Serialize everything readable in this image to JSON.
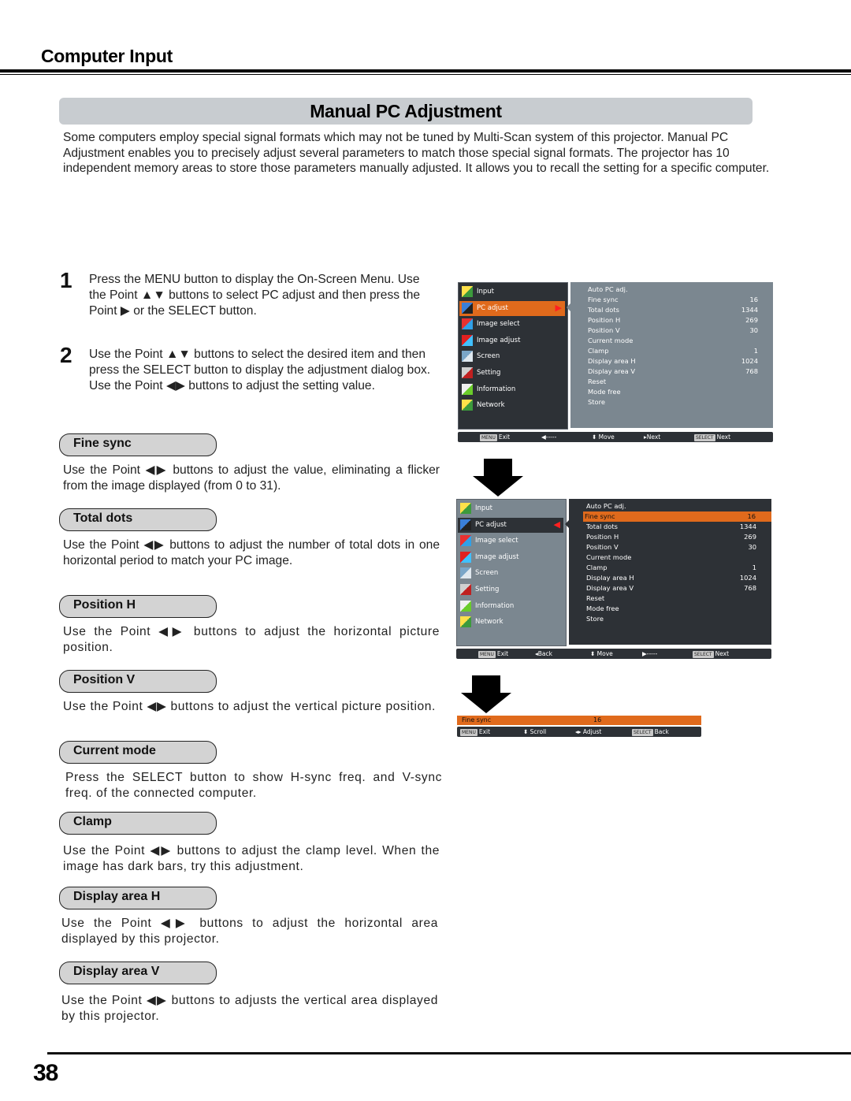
{
  "header": {
    "section_title": "Computer Input"
  },
  "banner": {
    "title": "Manual PC Adjustment"
  },
  "intro": "Some computers employ special signal formats which may not be tuned by Multi-Scan system of this projector. Manual PC Adjustment enables you to precisely adjust several parameters to match those special signal formats. The projector has 10 independent memory areas to store those parameters manually adjusted. It allows you to recall the setting for a specific computer.",
  "steps": [
    {
      "number": "1",
      "text": "Press the MENU button to display the On-Screen Menu. Use the Point ▲▼ buttons to select PC adjust and then press the Point ▶ or the SELECT button."
    },
    {
      "number": "2",
      "text": "Use the Point ▲▼ buttons to select the desired item and then press the SELECT button to display the adjustment dialog box. Use the Point ◀▶ buttons to adjust the setting value."
    }
  ],
  "items": [
    {
      "title": "Fine sync",
      "desc": "Use the Point ◀▶ buttons to adjust the value, eliminating a flicker from the image displayed (from 0 to 31)."
    },
    {
      "title": "Total dots",
      "desc": "Use the Point ◀▶ buttons to adjust the number of total dots in one horizontal period to match your PC image."
    },
    {
      "title": "Position H",
      "desc": "Use the Point ◀▶ buttons to adjust the horizontal picture position."
    },
    {
      "title": "Position V",
      "desc": "Use the Point ◀▶ buttons to adjust the vertical picture position."
    },
    {
      "title": "Current mode",
      "desc": "Press the SELECT button to show H-sync freq. and V-sync freq. of  the connected computer."
    },
    {
      "title": "Clamp",
      "desc": "Use the Point ◀▶ buttons to adjust the clamp level. When the image has dark bars, try this adjustment."
    },
    {
      "title": "Display area H",
      "desc": "Use the Point ◀▶ buttons to adjust the horizontal area displayed by this projector."
    },
    {
      "title": "Display area V",
      "desc": "Use the Point ◀▶ buttons to adjusts the vertical area displayed by this projector."
    }
  ],
  "osd": {
    "main_menu": [
      "Input",
      "PC adjust",
      "Image select",
      "Image adjust",
      "Screen",
      "Setting",
      "Information",
      "Network"
    ],
    "selected_main": "PC adjust",
    "submenu": [
      {
        "label": "Auto PC adj.",
        "value": ""
      },
      {
        "label": "Fine sync",
        "value": "16"
      },
      {
        "label": "Total dots",
        "value": "1344"
      },
      {
        "label": "Position H",
        "value": "269"
      },
      {
        "label": "Position V",
        "value": "30"
      },
      {
        "label": "Current mode",
        "value": ""
      },
      {
        "label": "Clamp",
        "value": "1"
      },
      {
        "label": "Display area H",
        "value": "1024"
      },
      {
        "label": "Display area V",
        "value": "768"
      },
      {
        "label": "Reset",
        "value": ""
      },
      {
        "label": "Mode free",
        "value": ""
      },
      {
        "label": "Store",
        "value": ""
      }
    ],
    "bar1": {
      "menu_key": "MENU",
      "exit": "Exit",
      "left": "◀-----",
      "move": "Move",
      "right": "Next",
      "select_key": "SELECT",
      "select": "Next"
    },
    "bar2": {
      "menu_key": "MENU",
      "exit": "Exit",
      "left": "Back",
      "move": "Move",
      "right": "▶-----",
      "select_key": "SELECT",
      "select": "Next"
    },
    "dialog": {
      "label": "Fine sync",
      "value": "16",
      "menu_key": "MENU",
      "exit": "Exit",
      "scroll": "Scroll",
      "adjust": "Adjust",
      "select_key": "SELECT",
      "back": "Back"
    },
    "colors": {
      "highlight": "#e06a1c",
      "panel_dark": "#2d3136",
      "panel_grey": "#7b8790",
      "arrow": "#ff2020"
    }
  },
  "page_number": "38"
}
